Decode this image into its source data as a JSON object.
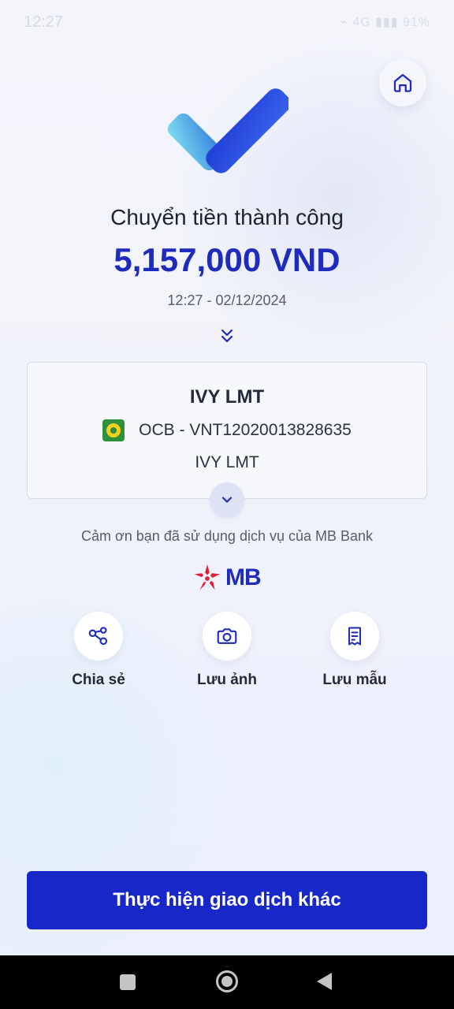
{
  "status_bar": {
    "time": "12:27",
    "right": "⌁ 4G ▮▮▮ 91%"
  },
  "header": {
    "home_icon": "home-icon"
  },
  "result": {
    "title": "Chuyển tiền thành công",
    "amount": "5,157,000 VND",
    "datetime": "12:27 - 02/12/2024"
  },
  "recipient": {
    "name": "IVY LMT",
    "account": "OCB - VNT12020013828635",
    "holder": "IVY LMT",
    "bank_logo_icon": "ocb-bank-logo"
  },
  "thanks": "Cảm ơn bạn đã sử dụng dịch vụ của MB Bank",
  "brand": {
    "logo_text": "MB",
    "colors": {
      "primary": "#1f2bbd",
      "accent": "#e0203a"
    }
  },
  "actions": [
    {
      "label": "Chia sẻ",
      "icon": "share-icon"
    },
    {
      "label": "Lưu ảnh",
      "icon": "camera-icon"
    },
    {
      "label": "Lưu mẫu",
      "icon": "receipt-icon"
    }
  ],
  "primary_button": {
    "label": "Thực hiện giao dịch khác"
  }
}
